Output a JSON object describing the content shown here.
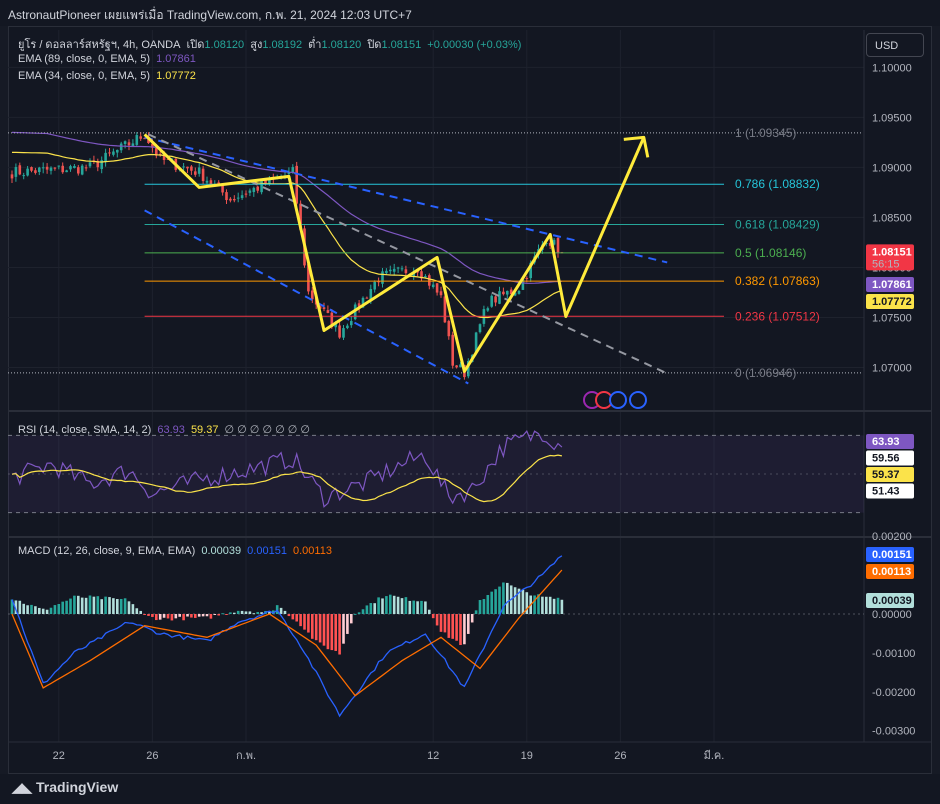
{
  "header": {
    "text": "AstronautPioneer เผยแพร่เมื่อ TradingView.com, ก.พ. 21, 2024 12:03 UTC+7"
  },
  "legend": {
    "symbol": "ยูโร / ดอลลาร์สหรัฐฯ, 4h, OANDA",
    "o_label": "เปิด",
    "o": "1.08120",
    "h_label": "สูง",
    "h": "1.08192",
    "l_label": "ต่ำ",
    "l": "1.08120",
    "c_label": "ปิด",
    "c": "1.08151",
    "chg": "+0.00030 (+0.03%)",
    "ema1_label": "EMA (89, close, 0, EMA, 5)",
    "ema1_value": "1.07861",
    "ema2_label": "EMA (34, close, 0, EMA, 5)",
    "ema2_value": "1.07772",
    "rsi_label": "RSI (14, close, SMA, 14, 2)",
    "rsi_value": "63.93",
    "rsi_ma": "59.37",
    "rsi_extras": "∅ ∅ ∅ ∅ ∅ ∅ ∅",
    "macd_label": "MACD (12, 26, close, 9, EMA, EMA)",
    "macd_hist": "0.00039",
    "macd_line": "0.00151",
    "macd_signal": "0.00113"
  },
  "toolbar": {
    "currency": "USD"
  },
  "footer": {
    "brand": "TradingView"
  },
  "colors": {
    "bg": "#131722",
    "up": "#26a69a",
    "down": "#ef5350",
    "ema89": "#7e57c2",
    "ema34": "#fbe34a",
    "pattern": "#ffeb3b",
    "channel": "#2962ff",
    "rsi": "#7e57c2",
    "macd": "#2962ff",
    "signal": "#ff6d00"
  },
  "chart_data": [
    {
      "type": "candlestick",
      "symbol": "EURUSD",
      "timeframe": "4h",
      "ylim": [
        1.068,
        1.1015
      ],
      "price_ticks": [
        "1.10000",
        "1.09500",
        "1.09000",
        "1.08500",
        "1.08000",
        "1.07500",
        "1.07000"
      ],
      "x_ticks": [
        "22",
        "26",
        "ก.พ.",
        "12",
        "19",
        "26",
        "มี.ค."
      ],
      "x_tick_index": [
        12,
        36,
        60,
        108,
        132,
        156,
        180
      ],
      "last_bar_index": 141,
      "key_points": [
        {
          "i": 0,
          "p": 1.0895
        },
        {
          "i": 20,
          "p": 1.09
        },
        {
          "i": 34,
          "p": 1.0933
        },
        {
          "i": 38,
          "p": 1.0908
        },
        {
          "i": 48,
          "p": 1.0895
        },
        {
          "i": 56,
          "p": 1.0868
        },
        {
          "i": 66,
          "p": 1.0885
        },
        {
          "i": 72,
          "p": 1.0895
        },
        {
          "i": 76,
          "p": 1.0775
        },
        {
          "i": 84,
          "p": 1.0735
        },
        {
          "i": 94,
          "p": 1.079
        },
        {
          "i": 104,
          "p": 1.08
        },
        {
          "i": 110,
          "p": 1.077
        },
        {
          "i": 113,
          "p": 1.0705
        },
        {
          "i": 116,
          "p": 1.0695
        },
        {
          "i": 122,
          "p": 1.0765
        },
        {
          "i": 130,
          "p": 1.078
        },
        {
          "i": 137,
          "p": 1.083
        },
        {
          "i": 141,
          "p": 1.08151
        }
      ],
      "ema89_last": 1.07861,
      "ema34_last": 1.07772,
      "fibonacci": [
        {
          "level": "1",
          "price": 1.09345,
          "label": "1 (1.09345)",
          "color": "#787b86"
        },
        {
          "level": "0.786",
          "price": 1.08832,
          "label": "0.786 (1.08832)",
          "color": "#26c6da"
        },
        {
          "level": "0.618",
          "price": 1.08429,
          "label": "0.618 (1.08429)",
          "color": "#26a69a"
        },
        {
          "level": "0.5",
          "price": 1.08146,
          "label": "0.5 (1.08146)",
          "color": "#4caf50"
        },
        {
          "level": "0.382",
          "price": 1.07863,
          "label": "0.382 (1.07863)",
          "color": "#ff9800"
        },
        {
          "level": "0.236",
          "price": 1.07512,
          "label": "0.236 (1.07512)",
          "color": "#f23645"
        },
        {
          "level": "0",
          "price": 1.06946,
          "label": "0 (1.06946)",
          "color": "#787b86"
        }
      ],
      "pattern_path": [
        {
          "i": 34,
          "p": 1.0933
        },
        {
          "i": 48,
          "p": 1.088
        },
        {
          "i": 71,
          "p": 1.0891
        },
        {
          "i": 80,
          "p": 1.0737
        },
        {
          "i": 109,
          "p": 1.081
        },
        {
          "i": 116,
          "p": 1.0696
        },
        {
          "i": 138,
          "p": 1.0833
        },
        {
          "i": 142,
          "p": 1.0751
        },
        {
          "i": 162,
          "p": 1.093
        }
      ],
      "channel_upper": [
        {
          "i": 34,
          "p": 1.093
        },
        {
          "i": 168,
          "p": 1.0805
        }
      ],
      "channel_lower": [
        {
          "i": 34,
          "p": 1.0857
        },
        {
          "i": 117,
          "p": 1.0684
        }
      ],
      "gray_line": [
        {
          "i": 35,
          "p": 1.0933
        },
        {
          "i": 168,
          "p": 1.0694
        }
      ],
      "price_tags": [
        {
          "value": "1.08151",
          "sub": "56:15",
          "price": 1.08151,
          "bg": "#f23645",
          "fg": "#ffffff"
        },
        {
          "value": "1.07861",
          "price": 1.07861,
          "bg": "#7e57c2",
          "fg": "#ffffff"
        },
        {
          "value": "1.07772",
          "price": 1.07772,
          "bg": "#fbe34a",
          "fg": "#131722"
        }
      ]
    },
    {
      "type": "line",
      "name": "RSI",
      "ylim": [
        20,
        80
      ],
      "key_points": [
        {
          "i": 0,
          "v": 48
        },
        {
          "i": 10,
          "v": 55
        },
        {
          "i": 20,
          "v": 45
        },
        {
          "i": 30,
          "v": 52
        },
        {
          "i": 36,
          "v": 40
        },
        {
          "i": 50,
          "v": 48
        },
        {
          "i": 60,
          "v": 52
        },
        {
          "i": 72,
          "v": 58
        },
        {
          "i": 80,
          "v": 38
        },
        {
          "i": 90,
          "v": 45
        },
        {
          "i": 100,
          "v": 55
        },
        {
          "i": 106,
          "v": 60
        },
        {
          "i": 112,
          "v": 38
        },
        {
          "i": 118,
          "v": 42
        },
        {
          "i": 126,
          "v": 64
        },
        {
          "i": 136,
          "v": 72
        },
        {
          "i": 141,
          "v": 63.93
        }
      ],
      "ma_last": 59.37,
      "axis_tags": [
        {
          "value": "63.93",
          "bg": "#7e57c2",
          "fg": "#ffffff"
        },
        {
          "value": "59.56",
          "bg": "#ffffff",
          "fg": "#131722"
        },
        {
          "value": "59.37",
          "bg": "#fbe34a",
          "fg": "#131722"
        },
        {
          "value": "51.43",
          "bg": "#ffffff",
          "fg": "#131722"
        }
      ]
    },
    {
      "type": "bar",
      "name": "MACD",
      "ylim": [
        -0.0032,
        0.0018
      ],
      "ticks": [
        "0.00200",
        "0.00000",
        "-0.00100",
        "-0.00200",
        "-0.00300"
      ],
      "macd_points": [
        {
          "i": 0,
          "v": 0.0004
        },
        {
          "i": 8,
          "v": -0.0018
        },
        {
          "i": 16,
          "v": -0.001
        },
        {
          "i": 30,
          "v": -0.0002
        },
        {
          "i": 38,
          "v": -0.0005
        },
        {
          "i": 50,
          "v": -0.0007
        },
        {
          "i": 58,
          "v": -0.0002
        },
        {
          "i": 68,
          "v": 0.0001
        },
        {
          "i": 74,
          "v": -0.0008
        },
        {
          "i": 84,
          "v": -0.0026
        },
        {
          "i": 96,
          "v": -0.001
        },
        {
          "i": 106,
          "v": -0.0005
        },
        {
          "i": 116,
          "v": -0.0019
        },
        {
          "i": 126,
          "v": 0.0002
        },
        {
          "i": 136,
          "v": 0.001
        },
        {
          "i": 141,
          "v": 0.00151
        }
      ],
      "signal_points": [
        {
          "i": 0,
          "v": 0.0
        },
        {
          "i": 8,
          "v": -0.0019
        },
        {
          "i": 20,
          "v": -0.0012
        },
        {
          "i": 34,
          "v": -0.0003
        },
        {
          "i": 50,
          "v": -0.0006
        },
        {
          "i": 66,
          "v": 0.0
        },
        {
          "i": 78,
          "v": -0.0008
        },
        {
          "i": 88,
          "v": -0.0021
        },
        {
          "i": 100,
          "v": -0.0012
        },
        {
          "i": 110,
          "v": -0.0006
        },
        {
          "i": 120,
          "v": -0.0014
        },
        {
          "i": 130,
          "v": -0.0001
        },
        {
          "i": 141,
          "v": 0.00113
        }
      ],
      "axis_tags": [
        {
          "value": "0.00151",
          "bg": "#2962ff",
          "fg": "#ffffff"
        },
        {
          "value": "0.00113",
          "bg": "#ff6d00",
          "fg": "#ffffff"
        },
        {
          "value": "0.00039",
          "bg": "#b2dfdb",
          "fg": "#131722"
        }
      ]
    }
  ]
}
